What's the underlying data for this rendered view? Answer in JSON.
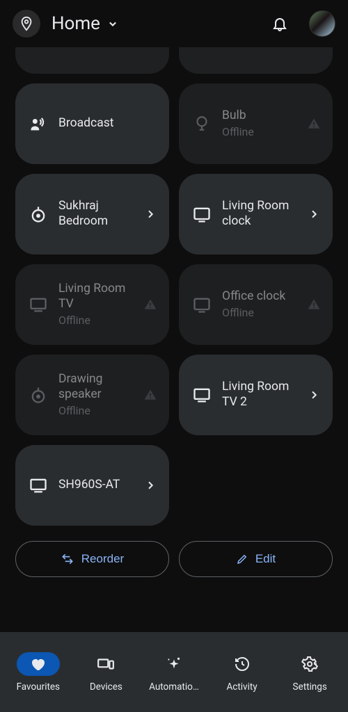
{
  "header": {
    "title": "Home"
  },
  "offline_text": "Offline",
  "tiles": {
    "broadcast": {
      "label": "Broadcast"
    },
    "bulb": {
      "label": "Bulb"
    },
    "sukhraj": {
      "label": "Sukhraj Bedroom"
    },
    "lr_clock": {
      "label": "Living Room clock"
    },
    "lr_tv": {
      "label": "Living Room TV"
    },
    "office_clock": {
      "label": "Office clock"
    },
    "drawing_speaker": {
      "label": "Drawing speaker"
    },
    "lr_tv2": {
      "label": "Living Room TV 2"
    },
    "sh960s": {
      "label": "SH960S-AT"
    }
  },
  "actions": {
    "reorder": "Reorder",
    "edit": "Edit"
  },
  "nav": {
    "favourites": "Favourites",
    "devices": "Devices",
    "automations": "Automatio…",
    "activity": "Activity",
    "settings": "Settings"
  }
}
